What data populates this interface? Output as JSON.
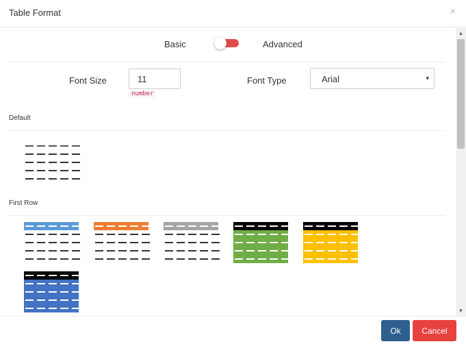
{
  "dialog": {
    "title": "Table Format",
    "close_symbol": "×"
  },
  "mode": {
    "basic_label": "Basic",
    "advanced_label": "Advanced",
    "toggle_state": "advanced",
    "toggle_color": "#e04b4b"
  },
  "font": {
    "size_label": "Font Size",
    "size_value": "11",
    "size_badge": "number",
    "type_label": "Font Type",
    "type_value": "Arial",
    "type_arrow": "▾"
  },
  "sections": {
    "default_label": "Default",
    "first_row_label": "First Row"
  },
  "styles": {
    "default": [
      {
        "name": "default-plain",
        "header_color": "#ffffff",
        "body_color": "#ffffff",
        "header_dash": "#555555",
        "body_dash": "#333333"
      }
    ],
    "first_row": [
      {
        "name": "first-row-blue-header",
        "header_color": "#5b9bd5",
        "body_color": "#ffffff",
        "header_dash": "#ffffff",
        "body_dash": "#333333"
      },
      {
        "name": "first-row-orange-header",
        "header_color": "#ed7d31",
        "body_color": "#ffffff",
        "header_dash": "#ffffff",
        "body_dash": "#333333"
      },
      {
        "name": "first-row-gray-header",
        "header_color": "#a5a5a5",
        "body_color": "#ffffff",
        "header_dash": "#ffffff",
        "body_dash": "#333333"
      },
      {
        "name": "first-row-black-green",
        "header_color": "#000000",
        "body_color": "#70ad47",
        "header_dash": "#ffffff",
        "body_dash": "#ffffff"
      },
      {
        "name": "first-row-black-yellow",
        "header_color": "#000000",
        "body_color": "#ffc000",
        "header_dash": "#ffffff",
        "body_dash": "#ffffff"
      },
      {
        "name": "first-row-black-blue",
        "header_color": "#000000",
        "body_color": "#4472c4",
        "header_dash": "#ffffff",
        "body_dash": "#ffffff"
      }
    ]
  },
  "footer": {
    "ok_label": "Ok",
    "cancel_label": "Cancel",
    "ok_color": "#2e5f8e",
    "cancel_color": "#e8423f"
  },
  "scrollbar": {
    "up_arrow": "▲",
    "down_arrow": "▼"
  }
}
